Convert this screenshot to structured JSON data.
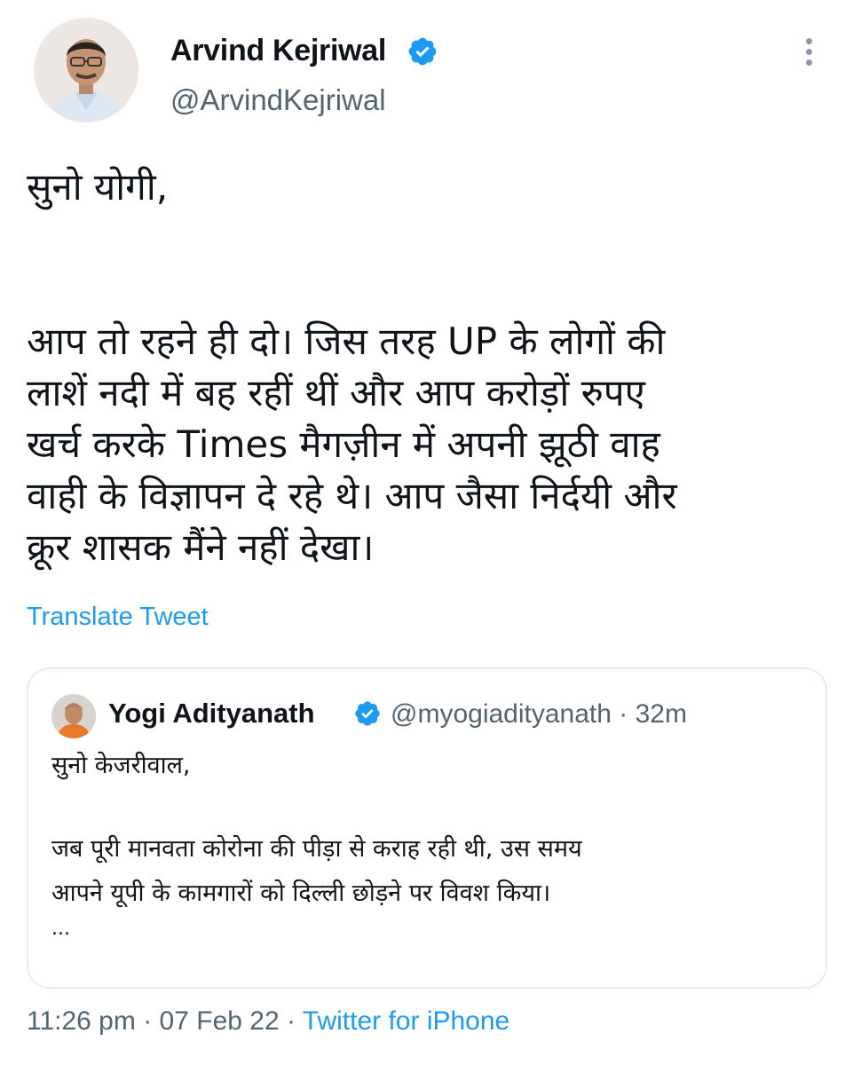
{
  "author": {
    "display_name": "Arvind Kejriwal",
    "handle": "@ArvindKejriwal",
    "verified": true
  },
  "tweet": {
    "lines": [
      "सुनो योगी,",
      "",
      "आप तो रहने ही दो। जिस तरह UP के लोगों की",
      "लाशें नदी में बह रहीं थीं और आप करोड़ों रुपए",
      "खर्च करके Times मैगज़ीन में अपनी झूठी वाह",
      "वाही के विज्ञापन दे रहे थे। आप जैसा निर्दयी और",
      "क्रूर शासक मैंने नहीं देखा।"
    ],
    "translate_label": "Translate Tweet"
  },
  "quoted_tweet": {
    "display_name": "Yogi Adityanath",
    "meta": "@myogiadityanath · 32m",
    "verified": true,
    "lines": [
      "सुनो केजरीवाल,",
      "",
      "जब पूरी मानवता कोरोना की पीड़ा से कराह रही थी, उस समय",
      "आपने यूपी के कामगारों को दिल्ली छोड़ने पर विवश किया।",
      "..."
    ]
  },
  "footer": {
    "time": "11:26 pm",
    "date": "07 Feb 22",
    "separator": "·",
    "source": "Twitter for iPhone"
  },
  "colors": {
    "link": "#1d9bf0",
    "secondary_text": "#536471",
    "primary_text": "#0f1419",
    "border": "#e6ecf0"
  },
  "icons": {
    "more": "more-vertical-icon",
    "verified": "verified-badge-icon"
  }
}
